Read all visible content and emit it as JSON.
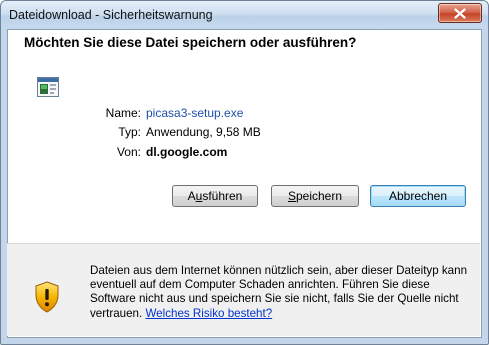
{
  "window": {
    "title": "Dateidownload - Sicherheitswarnung"
  },
  "dialog": {
    "heading": "Möchten Sie diese Datei speichern oder ausführen?",
    "fields": [
      {
        "label": "Name:",
        "value": "picasa3-setup.exe",
        "color": "#1f4fa8"
      },
      {
        "label": "Typ:",
        "value": "Anwendung, 9,58 MB",
        "color": "#000000"
      },
      {
        "label": "Von:",
        "value": "dl.google.com",
        "color": "#000000"
      }
    ],
    "file_icon": "application-file-icon"
  },
  "buttons": {
    "run": {
      "pre": "A",
      "mnemonic": "u",
      "post": "sführen"
    },
    "save": {
      "pre": "",
      "mnemonic": "S",
      "post": "peichern"
    },
    "cancel": {
      "label": "Abbrechen"
    }
  },
  "warning": {
    "icon": "security-shield-icon",
    "text": "Dateien aus dem Internet können nützlich sein, aber dieser Dateityp kann eventuell auf dem Computer Schaden anrichten. Führen Sie diese Software nicht aus und speichern Sie sie nicht, falls Sie der Quelle nicht vertrauen.",
    "link": "Welches Risiko besteht?"
  },
  "colors": {
    "link": "#0033cc",
    "close_button": "#c44428",
    "titlebar": "#c3d6ea"
  }
}
